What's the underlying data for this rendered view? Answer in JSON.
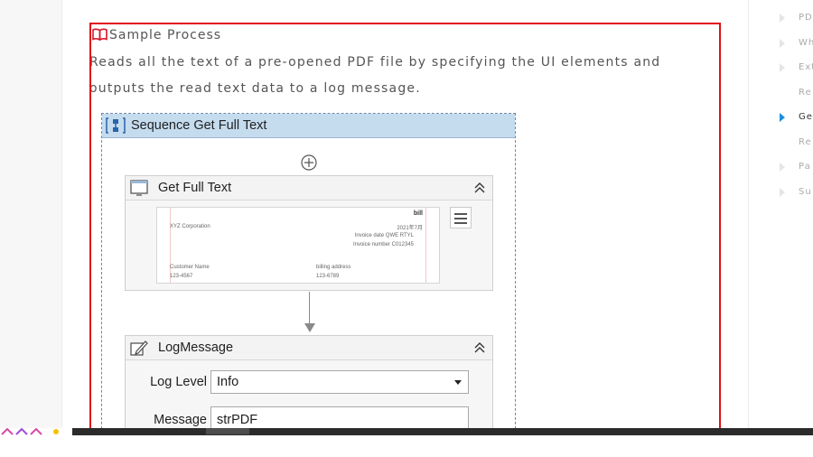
{
  "sample": {
    "title": "Sample Process",
    "description": "Reads all the text of a pre-opened PDF file by specifying the UI elements and outputs the read text data to a log message."
  },
  "toc": {
    "items": [
      {
        "label": "PDF",
        "active": false
      },
      {
        "label": "Wh",
        "active": false
      },
      {
        "label": "Ext",
        "active": false
      },
      {
        "label": "Re",
        "active": false
      },
      {
        "label": "Ge",
        "active": true
      },
      {
        "label": "Re",
        "active": false
      },
      {
        "label": "Pa",
        "active": false
      },
      {
        "label": "Su",
        "active": false
      }
    ]
  },
  "sequence": {
    "title": "Sequence  Get Full Text",
    "get_full_text": {
      "title": "Get Full Text",
      "preview": {
        "doc_title": "bill",
        "company": "XYZ Corporation",
        "date": "2021年7月",
        "invoice_date": "Invoice date QWE RTYL",
        "invoice_number": "Invoice number C012345",
        "customer_label": "Customer Name",
        "customer_value": "123-4567",
        "billing_label": "billing address",
        "billing_value": "123-6789"
      }
    },
    "log_message": {
      "title": "LogMessage",
      "log_level_label": "Log Level",
      "log_level_value": "Info",
      "message_label": "Message",
      "message_value": "strPDF"
    }
  },
  "colors": {
    "highlight": "#e0101a",
    "sequence_header": "#c5dcef",
    "toc_active": "#1a8fe3"
  }
}
